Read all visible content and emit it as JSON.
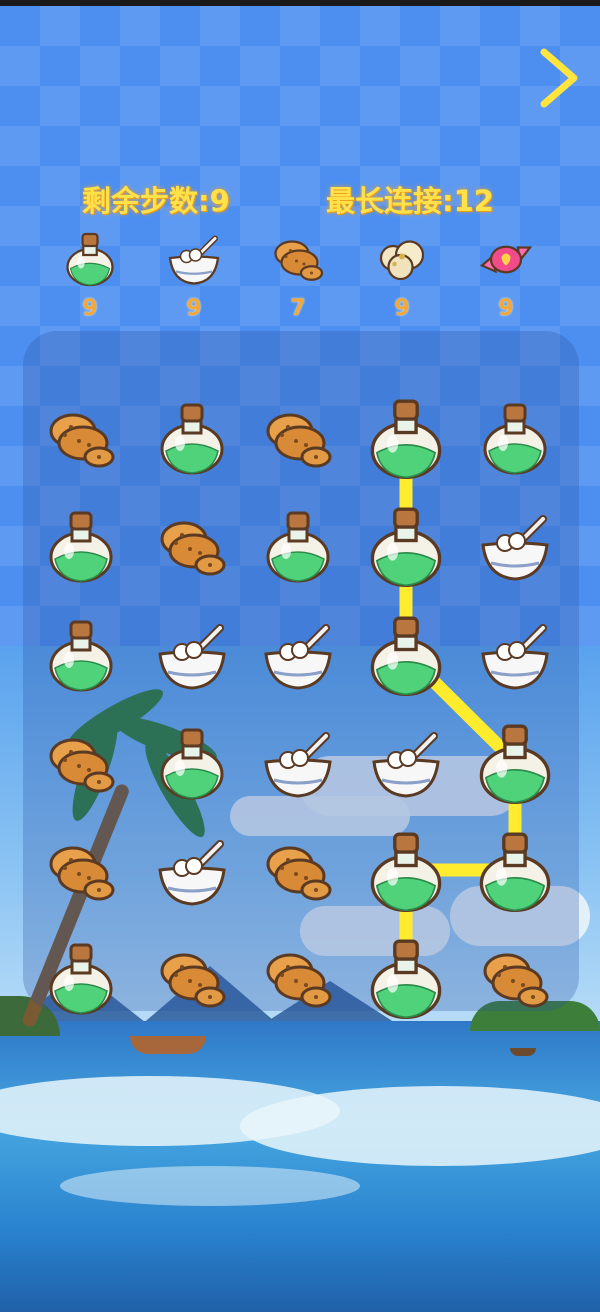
{
  "header": {
    "moves_label": "剩余步数:9",
    "chain_label": "最长连接:12",
    "next_icon": "chevron-right-icon"
  },
  "goals": [
    {
      "item": "potion",
      "count": "9"
    },
    {
      "item": "bowl",
      "count": "9"
    },
    {
      "item": "cookies",
      "count": "7"
    },
    {
      "item": "popcorn",
      "count": "9"
    },
    {
      "item": "candy",
      "count": "9"
    }
  ],
  "board": {
    "columns": 5,
    "rows": 6,
    "grid": [
      [
        "cookies",
        "potion",
        "cookies",
        "potion",
        "potion"
      ],
      [
        "potion",
        "cookies",
        "potion",
        "potion",
        "bowl"
      ],
      [
        "potion",
        "bowl",
        "bowl",
        "potion",
        "bowl"
      ],
      [
        "cookies",
        "potion",
        "bowl",
        "bowl",
        "potion"
      ],
      [
        "cookies",
        "bowl",
        "cookies",
        "potion",
        "potion"
      ],
      [
        "potion",
        "cookies",
        "cookies",
        "potion",
        "cookies"
      ]
    ],
    "chain": [
      [
        0,
        3
      ],
      [
        1,
        3
      ],
      [
        2,
        3
      ],
      [
        3,
        4
      ],
      [
        4,
        4
      ],
      [
        4,
        3
      ],
      [
        5,
        3
      ]
    ],
    "chain_color": "#ffec2e"
  },
  "colors": {
    "stat_text": "#ffe24a",
    "goal_count": "#f3a83a",
    "potion_liquid": "#4fd27a",
    "cork": "#b9773f"
  }
}
